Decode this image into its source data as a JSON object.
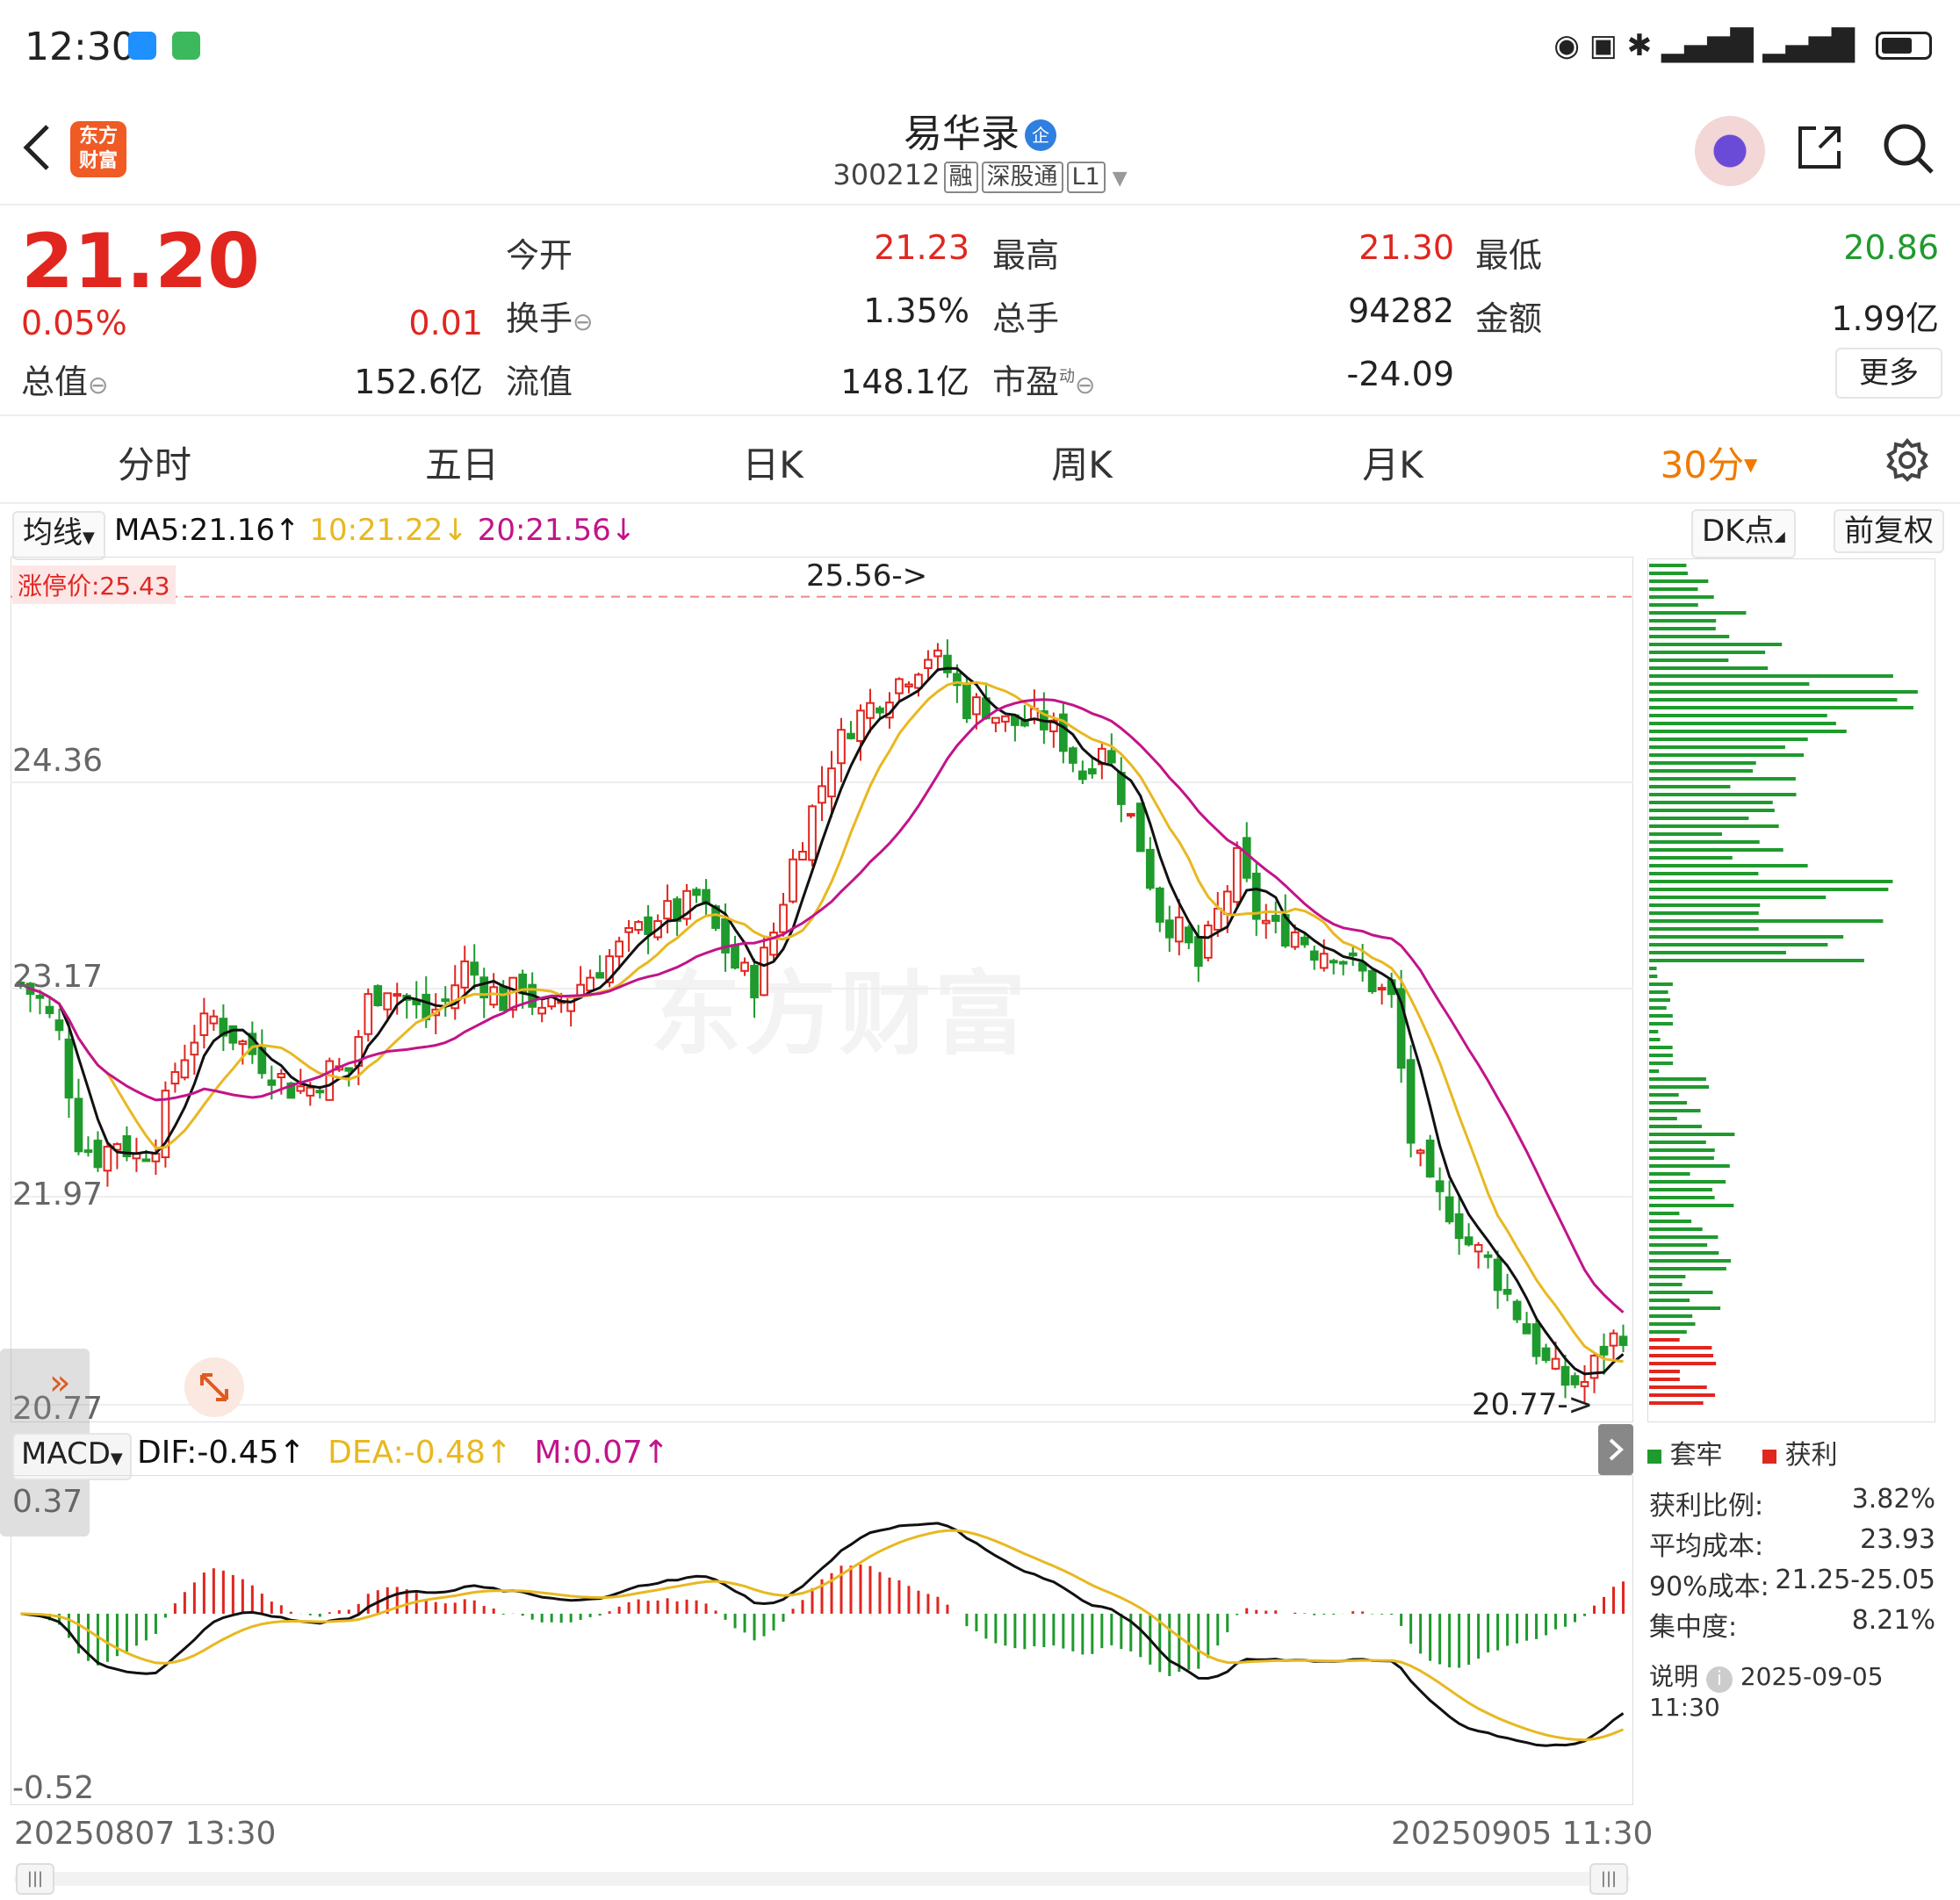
{
  "status_bar": {
    "time": "12:30"
  },
  "header": {
    "logo_text_line1": "东方",
    "logo_text_line2": "财富",
    "stock_name": "易华录",
    "name_badge": "企",
    "code": "300212",
    "tags": [
      "融",
      "深股通",
      "L1"
    ]
  },
  "quote": {
    "price": "21.20",
    "change_pct": "0.05%",
    "change": "0.01",
    "rows": [
      [
        {
          "label": "今开",
          "value": "21.23",
          "color": "#e0261f"
        },
        {
          "label": "最高",
          "value": "21.30",
          "color": "#e0261f"
        },
        {
          "label": "最低",
          "value": "20.86",
          "color": "#1f9a2d"
        }
      ],
      [
        {
          "label": "换手",
          "value": "1.35%",
          "color": "#222222"
        },
        {
          "label": "总手",
          "value": "94282",
          "color": "#222222"
        },
        {
          "label": "金额",
          "value": "1.99亿",
          "color": "#222222"
        }
      ],
      [
        {
          "label": "流值",
          "value": "148.1亿",
          "color": "#222222"
        },
        {
          "label": "市盈",
          "value": "-24.09",
          "color": "#222222"
        }
      ]
    ],
    "total_value_label": "总值",
    "total_value": "152.6亿",
    "pe_sup": "动",
    "more_label": "更多"
  },
  "tabs": [
    {
      "label": "分时",
      "active": false
    },
    {
      "label": "五日",
      "active": false
    },
    {
      "label": "日K",
      "active": false
    },
    {
      "label": "周K",
      "active": false
    },
    {
      "label": "月K",
      "active": false
    },
    {
      "label": "30分",
      "active": true
    }
  ],
  "indicator": {
    "ma_selector": "均线",
    "ma5": "MA5:21.16",
    "ma10": "10:21.22",
    "ma20": "20:21.56",
    "dk_label": "DK点",
    "fq_label": "前复权"
  },
  "colors": {
    "up": "#e0261f",
    "down": "#1f9a2d",
    "ma5": "#111111",
    "ma10": "#e8b820",
    "ma20": "#c2148a"
  },
  "chart_data": {
    "type": "candlestick",
    "y_ticks": [
      "24.36",
      "23.17",
      "21.97",
      "20.77"
    ],
    "ylim": [
      20.77,
      25.56
    ],
    "limit_up_label": "涨停价:25.43",
    "limit_up": 25.43,
    "high_annotation": "25.56->",
    "low_annotation": "20.77->",
    "x_start": "20250807 13:30",
    "x_end": "20250905 11:30",
    "closes": [
      23.2,
      23.1,
      22.9,
      22.3,
      22.2,
      22.3,
      22.2,
      22.3,
      22.7,
      22.9,
      23.0,
      22.9,
      22.8,
      22.7,
      22.6,
      22.6,
      22.7,
      22.7,
      23.1,
      23.2,
      23.1,
      23.0,
      23.1,
      23.3,
      23.2,
      23.1,
      23.2,
      23.0,
      23.1,
      23.2,
      23.3,
      23.4,
      23.5,
      23.6,
      23.6,
      23.7,
      23.5,
      23.3,
      23.2,
      23.5,
      23.9,
      24.2,
      24.5,
      24.7,
      24.8,
      24.9,
      25.0,
      25.1,
      25.0,
      24.8,
      24.8,
      24.7,
      24.7,
      24.7,
      24.6,
      24.4,
      24.6,
      24.3,
      24.0,
      23.6,
      23.5,
      23.3,
      23.6,
      23.9,
      23.6,
      23.5,
      23.5,
      23.4,
      23.4,
      23.3,
      23.2,
      23.1,
      22.3,
      22.0,
      21.9,
      21.7,
      21.6,
      21.4,
      21.2,
      21.0,
      20.9,
      20.9,
      21.1,
      21.2
    ],
    "ma5": "21.16",
    "ma10": "21.22",
    "ma20": "21.56"
  },
  "macd": {
    "selector": "MACD",
    "dif": "DIF:-0.45",
    "dea": "DEA:-0.48",
    "m": "M:0.07",
    "y_max_label": "0.37",
    "y_min_label": "-0.52"
  },
  "chip": {
    "legend_trapped": "套牢",
    "legend_profit": "获利",
    "rows": [
      {
        "label": "获利比例:",
        "value": "3.82%"
      },
      {
        "label": "平均成本:",
        "value": "23.93"
      },
      {
        "label": "90%成本:",
        "value": "21.25-25.05"
      },
      {
        "label": "集中度:",
        "value": "8.21%"
      }
    ],
    "note_label": "说明",
    "note_time": "2025-09-05 11:30"
  },
  "watermark": "东方财富",
  "scroll_handle_glyph": "|||"
}
